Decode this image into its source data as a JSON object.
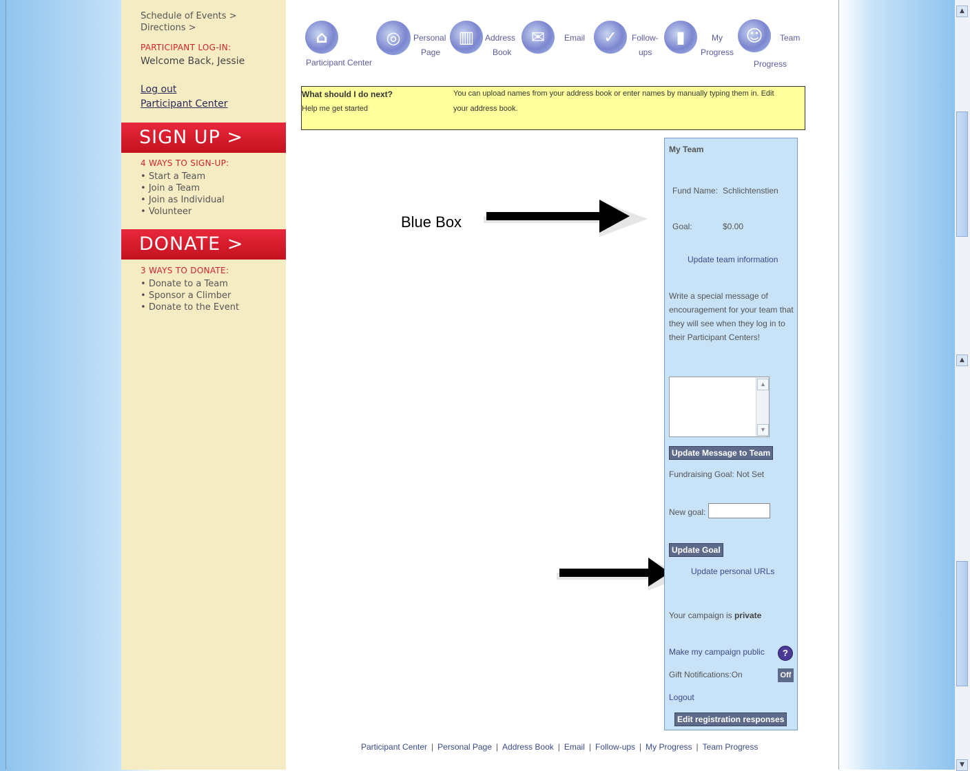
{
  "sidebar": {
    "schedule_link": "Schedule of Events >",
    "directions_link": "Directions >",
    "login_label": "PARTICIPANT LOG-IN:",
    "welcome": "Welcome Back, Jessie",
    "logout": "Log out",
    "participant_center": "Participant Center",
    "signup_banner": "SIGN UP >",
    "signup_heading": "4 WAYS TO SIGN-UP:",
    "signup_items": [
      "Start a Team",
      "Join a Team",
      "Join as Individual",
      "Volunteer"
    ],
    "donate_banner": "DONATE >",
    "donate_heading": "3 WAYS TO DONATE:",
    "donate_items": [
      "Donate to a Team",
      "Sponsor a Climber",
      "Donate to the Event"
    ]
  },
  "nav": {
    "participant_center": "Participant Center",
    "personal_page_1": "Personal",
    "personal_page_2": "Page",
    "address_book_1": "Address",
    "address_book_2": "Book",
    "email": "Email",
    "followups_1": "Follow-",
    "followups_2": "ups",
    "my_progress_1": "My",
    "my_progress_2": "Progress",
    "team_progress_1": "Team",
    "team_progress_2": "Progress"
  },
  "next_box": {
    "question": "What should I do next?",
    "help": "Help me get started",
    "message_1": "You can upload names from your address book or enter names by manually typing them in. Edit",
    "message_2": "your address book."
  },
  "annotation": {
    "blue_box_label": "Blue Box"
  },
  "team_box": {
    "title": "My Team",
    "fund_label": "Fund Name:",
    "fund_value": "Schlichtenstien",
    "goal_label": "Goal:",
    "goal_value": "$0.00",
    "update_team": "Update team information",
    "message_1": "Write a special message of",
    "message_2": "encouragement for your team that",
    "message_3": "they will see when they log in to",
    "message_4": "their Participant Centers!",
    "update_message_button": "Update Message to Team",
    "fundraising_goal": "Fundraising Goal: Not Set",
    "new_goal_label": "New goal:",
    "update_goal_button": "Update Goal",
    "update_urls": "Update personal URLs",
    "campaign_prefix": "Your campaign is ",
    "campaign_status": "private",
    "make_public": "Make my campaign public",
    "gift_notifications": "Gift Notifications:On",
    "off_button": "Off",
    "logout": "Logout",
    "edit_registration": "Edit registration responses"
  },
  "footer": {
    "links": [
      "Participant Center",
      "Personal Page",
      "Address Book",
      "Email",
      "Follow-ups",
      "My Progress",
      "Team Progress"
    ]
  },
  "colors": {
    "sidebar_bg": "#f6ecc4",
    "banner_red": "#d2232a",
    "yellow_box": "#ffff9c",
    "blue_box": "#c8e2f8",
    "button_dark": "#5d6a8a"
  }
}
